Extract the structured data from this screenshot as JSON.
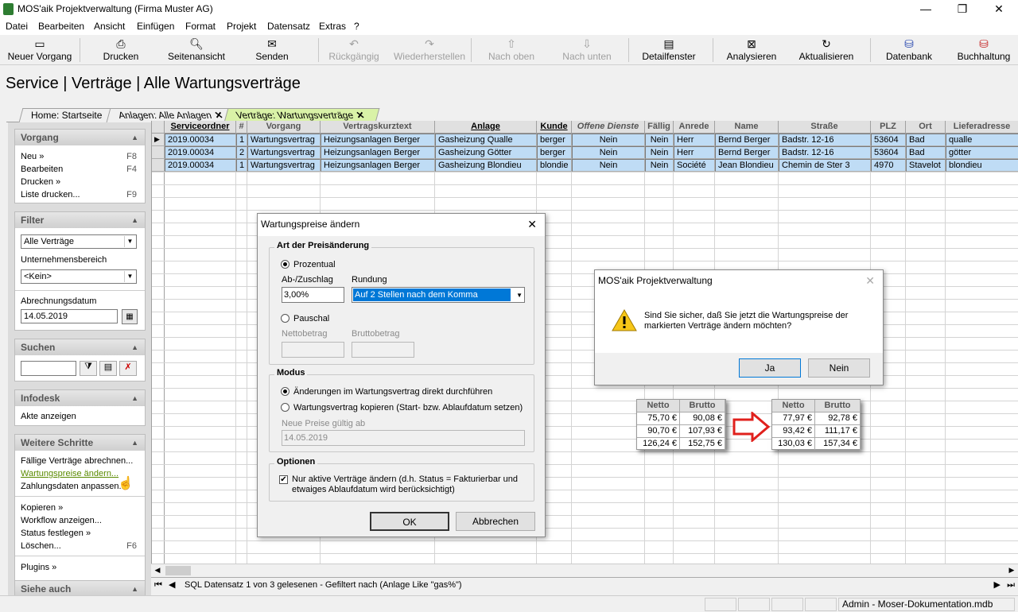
{
  "window": {
    "title": "MOS'aik Projektverwaltung (Firma Muster AG)"
  },
  "menu": [
    "Datei",
    "Bearbeiten",
    "Ansicht",
    "Einfügen",
    "Format",
    "Projekt",
    "Datensatz",
    "Extras",
    "?"
  ],
  "toolbar": {
    "neuer_vorgang": "Neuer Vorgang",
    "drucken": "Drucken",
    "seitenansicht": "Seitenansicht",
    "senden": "Senden",
    "rueckgaengig": "Rückgängig",
    "wiederherstellen": "Wiederherstellen",
    "nach_oben": "Nach oben",
    "nach_unten": "Nach unten",
    "detailfenster": "Detailfenster",
    "analysieren": "Analysieren",
    "aktualisieren": "Aktualisieren",
    "datenbank": "Datenbank",
    "buchhaltung": "Buchhaltung"
  },
  "heading": "Service | Verträge | Alle Wartungsverträge",
  "tabs": [
    "Home: Startseite",
    "Anlagen: Alle Anlagen",
    "Verträge: Wartungsverträge"
  ],
  "sidebar": {
    "vorgang": {
      "title": "Vorgang",
      "items": [
        {
          "label": "Neu »",
          "key": "F8"
        },
        {
          "label": "Bearbeiten",
          "key": "F4"
        },
        {
          "label": "Drucken »",
          "key": ""
        },
        {
          "label": "Liste drucken...",
          "key": "F9"
        }
      ]
    },
    "filter": {
      "title": "Filter",
      "select1": "Alle Verträge",
      "label2": "Unternehmensbereich",
      "select2": "<Kein>",
      "label3": "Abrechnungsdatum",
      "date": "14.05.2019"
    },
    "suchen": {
      "title": "Suchen"
    },
    "infodesk": {
      "title": "Infodesk",
      "items": [
        "Akte anzeigen"
      ]
    },
    "weitere": {
      "title": "Weitere Schritte",
      "items": [
        "Fällige Verträge abrechnen...",
        "Wartungspreise ändern...",
        "Zahlungsdaten anpassen...",
        "Kopieren »",
        "Workflow anzeigen...",
        "Status festlegen »",
        "Löschen..."
      ],
      "loeschen_key": "F6",
      "plugins": "Plugins »"
    },
    "siehe": {
      "title": "Siehe auch"
    }
  },
  "grid": {
    "columns": [
      "Serviceordner",
      "#",
      "Vorgang",
      "Vertragskurztext",
      "Anlage",
      "Kunde",
      "Offene Dienste",
      "Fällig",
      "Anrede",
      "Name",
      "Straße",
      "PLZ",
      "Ort",
      "Lieferadresse"
    ],
    "rows": [
      [
        "2019.00034",
        "1",
        "Wartungsvertrag",
        "Heizungsanlagen Berger",
        "Gasheizung Qualle",
        "berger",
        "Nein",
        "Nein",
        "Herr",
        "Bernd Berger",
        "Badstr. 12-16",
        "53604",
        "Bad",
        "qualle"
      ],
      [
        "2019.00034",
        "2",
        "Wartungsvertrag",
        "Heizungsanlagen Berger",
        "Gasheizung Götter",
        "berger",
        "Nein",
        "Nein",
        "Herr",
        "Bernd Berger",
        "Badstr. 12-16",
        "53604",
        "Bad",
        "götter"
      ],
      [
        "2019.00034",
        "1",
        "Wartungsvertrag",
        "Heizungsanlagen Berger",
        "Gasheizung Blondieu",
        "blondie",
        "Nein",
        "Nein",
        "Société",
        "Jean Blondieu",
        "Chemin de Ster 3",
        "4970",
        "Stavelot",
        "blondieu"
      ]
    ]
  },
  "status": "SQL Datensatz 1 von 3 gelesenen - Gefiltert nach (Anlage Like \"gas%\")",
  "bottom": "Admin - Moser-Dokumentation.mdb",
  "dialog": {
    "title": "Wartungspreise ändern",
    "group1": "Art der Preisänderung",
    "prozentual": "Prozentual",
    "abzuschlag": "Ab-/Zuschlag",
    "rundung": "Rundung",
    "abzuschlag_value": "3,00%",
    "rundung_value": "Auf 2 Stellen nach dem Komma",
    "pauschal": "Pauschal",
    "netto": "Nettobetrag",
    "brutto": "Bruttobetrag",
    "group2": "Modus",
    "modus1": "Änderungen im Wartungsvertrag direkt durchführen",
    "modus2": "Wartungsvertrag kopieren (Start- bzw. Ablaufdatum setzen)",
    "neue_preise": "Neue Preise gültig ab",
    "neue_preise_value": "14.05.2019",
    "group3": "Optionen",
    "option1": "Nur aktive Verträge ändern (d.h. Status = Fakturierbar und etwaiges Ablaufdatum wird berücksichtigt)",
    "ok": "OK",
    "cancel": "Abbrechen"
  },
  "confirm": {
    "title": "MOS'aik Projektverwaltung",
    "message": "Sind Sie sicher, daß Sie jetzt die Wartungspreise der markierten Verträge ändern möchten?",
    "yes": "Ja",
    "no": "Nein"
  },
  "prices_before": {
    "headers": [
      "Netto",
      "Brutto"
    ],
    "rows": [
      [
        "75,70 €",
        "90,08 €"
      ],
      [
        "90,70 €",
        "107,93 €"
      ],
      [
        "126,24 €",
        "152,75 €"
      ]
    ]
  },
  "prices_after": {
    "headers": [
      "Netto",
      "Brutto"
    ],
    "rows": [
      [
        "77,97 €",
        "92,78 €"
      ],
      [
        "93,42 €",
        "111,17 €"
      ],
      [
        "130,03 €",
        "157,34 €"
      ]
    ]
  }
}
